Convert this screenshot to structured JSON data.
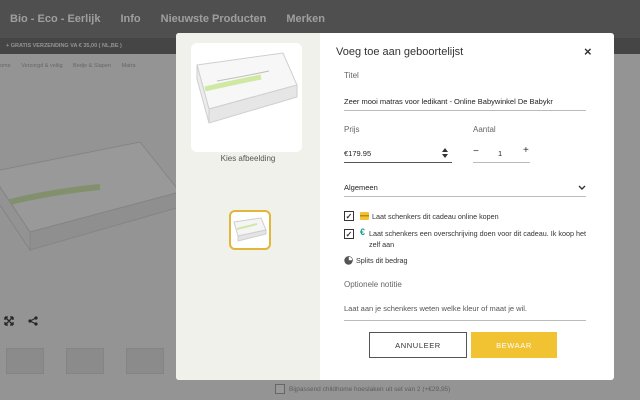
{
  "nav": {
    "items": [
      "Bio - Eco - Eerlijk",
      "Info",
      "Nieuwste Producten",
      "Merken"
    ]
  },
  "shipping_banner": "+ GRATIS VERZENDING VA € 35,00  ( NL,BE )",
  "breadcrumbs": [
    "ome",
    "Verzorgd & veilig",
    "Bedje & Slapen",
    "Matra"
  ],
  "footer_option": "Bijpassend childhome hoeslaken uit set van 2 (+€29,95)",
  "modal": {
    "title": "Voeg toe aan geboortelijst",
    "close_label": "×",
    "choose_image": "Kies afbeelding",
    "title_label": "Titel",
    "title_value": "Zeer mooi matras voor ledikant - Online Babywinkel De Babykr",
    "price_label": "Prijs",
    "price_value": "€179.95",
    "qty_label": "Aantal",
    "qty_minus": "−",
    "qty_value": "1",
    "qty_plus": "+",
    "category_value": "Algemeen",
    "checkbox1": "Laat schenkers dit cadeau online kopen",
    "checkbox2": "Laat schenkers een overschrijving doen voor dit cadeau. Ik koop het zelf aan",
    "split_label": "Splits dit bedrag",
    "note_label": "Optionele notitie",
    "note_placeholder": "Laat aan je schenkers weten welke kleur of maat je wil.",
    "cancel_label": "ANNULEER",
    "save_label": "BEWAAR"
  },
  "colors": {
    "accent": "#f1c232",
    "nav_bg": "#6f6f6f"
  },
  "icons": [
    "expand-icon",
    "share-icon",
    "gift-card-icon",
    "euro-icon",
    "pie-chart-icon",
    "chevron-down-icon",
    "spinner-icon",
    "close-icon"
  ]
}
